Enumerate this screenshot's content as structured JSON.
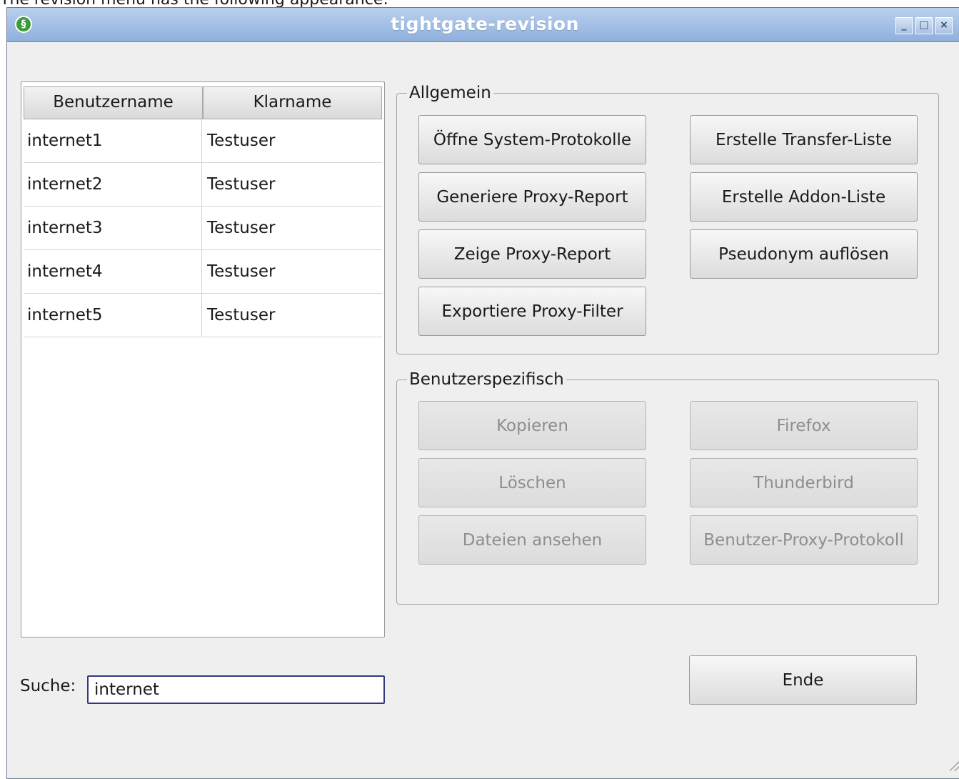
{
  "page": {
    "caption": "The revision menu has the following appearance:"
  },
  "window": {
    "title": "tightgate-revision",
    "app_icon_glyph": "§",
    "controls": {
      "minimize": "_",
      "maximize": "□",
      "close": "×"
    },
    "titlebar_color": "#8fb0dc"
  },
  "table": {
    "columns": [
      "Benutzername",
      "Klarname"
    ],
    "rows": [
      {
        "user": "internet1",
        "name": "Testuser"
      },
      {
        "user": "internet2",
        "name": "Testuser"
      },
      {
        "user": "internet3",
        "name": "Testuser"
      },
      {
        "user": "internet4",
        "name": "Testuser"
      },
      {
        "user": "internet5",
        "name": "Testuser"
      }
    ]
  },
  "search": {
    "label": "Suche:",
    "value": "internet"
  },
  "groups": {
    "allgemein": {
      "title": "Allgemein",
      "buttons": [
        "Öffne System-Protokolle",
        "Erstelle Transfer-Liste",
        "Generiere Proxy-Report",
        "Erstelle Addon-Liste",
        "Zeige Proxy-Report",
        "Pseudonym auflösen",
        "Exportiere Proxy-Filter"
      ]
    },
    "benutzerspezifisch": {
      "title": "Benutzerspezifisch",
      "buttons": [
        "Kopieren",
        "Firefox",
        "Löschen",
        "Thunderbird",
        "Dateien ansehen",
        "Benutzer-Proxy-Protokoll"
      ]
    }
  },
  "end_button": "Ende"
}
